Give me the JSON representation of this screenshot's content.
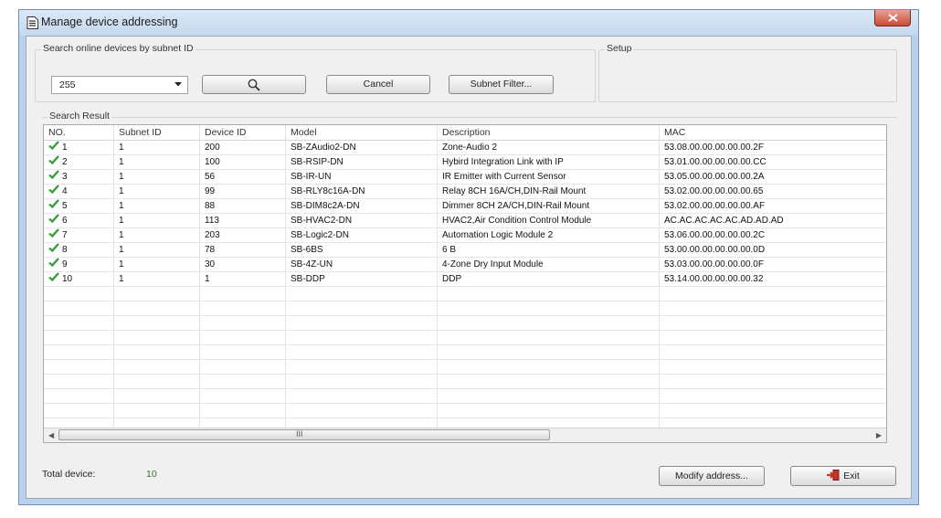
{
  "window": {
    "title": "Manage device addressing"
  },
  "search_group": {
    "label": "Search online devices by subnet ID",
    "subnet_value": "255",
    "cancel_label": "Cancel",
    "filter_label": "Subnet Filter..."
  },
  "setup_group": {
    "label": "Setup"
  },
  "result_group": {
    "label": "Search Result"
  },
  "table": {
    "columns": [
      "NO.",
      "Subnet ID",
      "Device ID",
      "Model",
      "Description",
      "MAC"
    ],
    "rows": [
      {
        "no": "1",
        "subnet": "1",
        "device": "200",
        "model": "SB-ZAudio2-DN",
        "desc": "Zone-Audio 2",
        "mac": "53.08.00.00.00.00.00.2F"
      },
      {
        "no": "2",
        "subnet": "1",
        "device": "100",
        "model": "SB-RSIP-DN",
        "desc": "Hybird Integration Link with IP",
        "mac": "53.01.00.00.00.00.00.CC"
      },
      {
        "no": "3",
        "subnet": "1",
        "device": "56",
        "model": "SB-IR-UN",
        "desc": "IR Emitter with Current Sensor",
        "mac": "53.05.00.00.00.00.00.2A"
      },
      {
        "no": "4",
        "subnet": "1",
        "device": "99",
        "model": "SB-RLY8c16A-DN",
        "desc": "Relay 8CH 16A/CH,DIN-Rail Mount",
        "mac": "53.02.00.00.00.00.00.65"
      },
      {
        "no": "5",
        "subnet": "1",
        "device": "88",
        "model": "SB-DIM8c2A-DN",
        "desc": "Dimmer 8CH 2A/CH,DIN-Rail Mount",
        "mac": "53.02.00.00.00.00.00.AF"
      },
      {
        "no": "6",
        "subnet": "1",
        "device": "113",
        "model": "SB-HVAC2-DN",
        "desc": "HVAC2,Air Condition Control Module",
        "mac": "AC.AC.AC.AC.AC.AD.AD.AD"
      },
      {
        "no": "7",
        "subnet": "1",
        "device": "203",
        "model": "SB-Logic2-DN",
        "desc": "Automation Logic Module 2",
        "mac": "53.06.00.00.00.00.00.2C"
      },
      {
        "no": "8",
        "subnet": "1",
        "device": "78",
        "model": "SB-6BS",
        "desc": "6 B",
        "mac": "53.00.00.00.00.00.00.0D"
      },
      {
        "no": "9",
        "subnet": "1",
        "device": "30",
        "model": "SB-4Z-UN",
        "desc": "4-Zone Dry Input Module",
        "mac": "53.03.00.00.00.00.00.0F"
      },
      {
        "no": "10",
        "subnet": "1",
        "device": "1",
        "model": "SB-DDP",
        "desc": "DDP",
        "mac": "53.14.00.00.00.00.00.32"
      }
    ]
  },
  "footer": {
    "total_label": "Total device:",
    "total_value": "10",
    "modify_label": "Modify address...",
    "exit_label": "Exit"
  },
  "scrollbar": {
    "grip": "III",
    "left_arrow": "◀",
    "right_arrow": "▶"
  },
  "colors": {
    "check": "#2e9a2e",
    "title_bar": "#c4d8ee",
    "close": "#c74a34"
  },
  "icons": [
    "document-icon",
    "close-icon",
    "search-icon",
    "dropdown-arrow-icon",
    "check-icon",
    "exit-icon"
  ]
}
